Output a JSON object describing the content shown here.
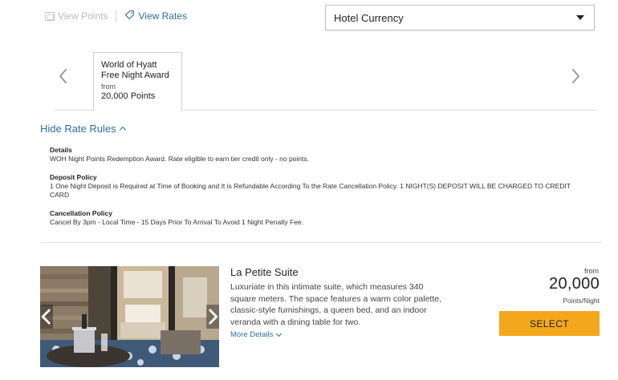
{
  "toolbar": {
    "view_points": "View Points",
    "view_rates": "View Rates",
    "currency_selected": "Hotel Currency"
  },
  "rate_tab": {
    "name_line1": "World of Hyatt",
    "name_line2": "Free Night Award",
    "from": "from",
    "points": "20,000 Points"
  },
  "rules_toggle": "Hide Rate Rules",
  "rules": [
    {
      "title": "Details",
      "text": "WOH Night Points Redemption Award. Rate eligible to earn tier credit only - no points."
    },
    {
      "title": "Deposit Policy",
      "text": "1 One Night Deposit is Required at Time of Booking and It is Refundable According To the Rate Cancellation Policy. 1 NIGHT(S) DEPOSIT WILL BE CHARGED TO CREDIT CARD"
    },
    {
      "title": "Cancellation Policy",
      "text": "Cancel By 3pm - Local Time - 15 Days Prior To Arrival To Avoid 1 Night Penalty Fee."
    }
  ],
  "room": {
    "title": "La Petite Suite",
    "description": "Luxuriate in this intimate suite, which measures 340 square meters. The space features a warm color palette, classic-style furnishings, a queen bed, and an indoor veranda with a dining table for two.",
    "more_details": "More Details",
    "price_from": "from",
    "price_value": "20,000",
    "price_unit": "Points/Night",
    "select_label": "SELECT"
  },
  "colors": {
    "link": "#2e6da4",
    "select_button": "#f3a71d"
  },
  "icons": [
    "view-points-icon",
    "tag-icon",
    "chevron-down-icon",
    "chevron-left-icon",
    "chevron-right-icon",
    "chevron-up-icon"
  ]
}
